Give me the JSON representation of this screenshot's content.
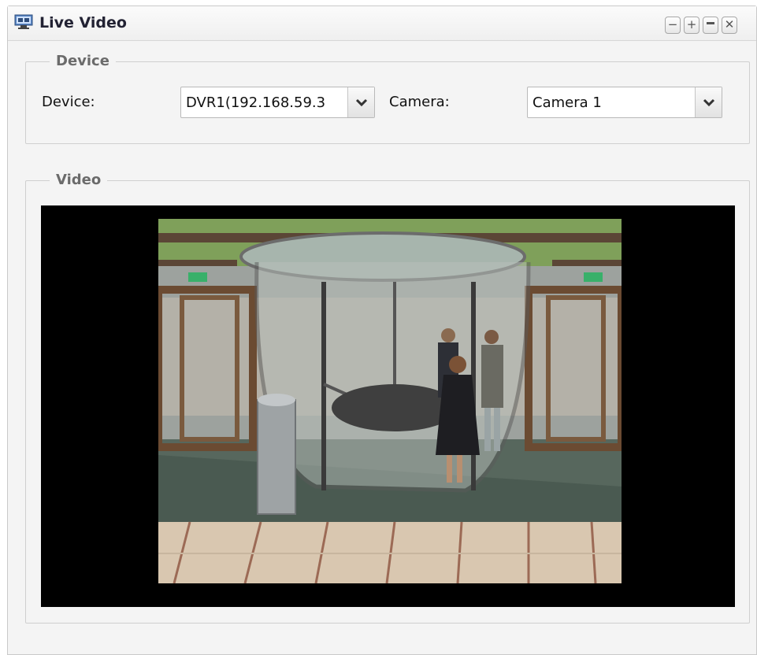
{
  "window": {
    "title": "Live Video",
    "icon": "camera-monitor-icon",
    "controls": [
      "minimize-icon",
      "maximize-icon",
      "restore-icon",
      "close-icon"
    ]
  },
  "device_group": {
    "legend": "Device",
    "device_label": "Device:",
    "device_value": "DVR1(192.168.59.3",
    "camera_label": "Camera:",
    "camera_value": "Camera 1"
  },
  "video_group": {
    "legend": "Video"
  },
  "colors": {
    "legend_text": "#6b6b6b",
    "video_background": "#000000",
    "panel_background": "#f4f4f4"
  }
}
